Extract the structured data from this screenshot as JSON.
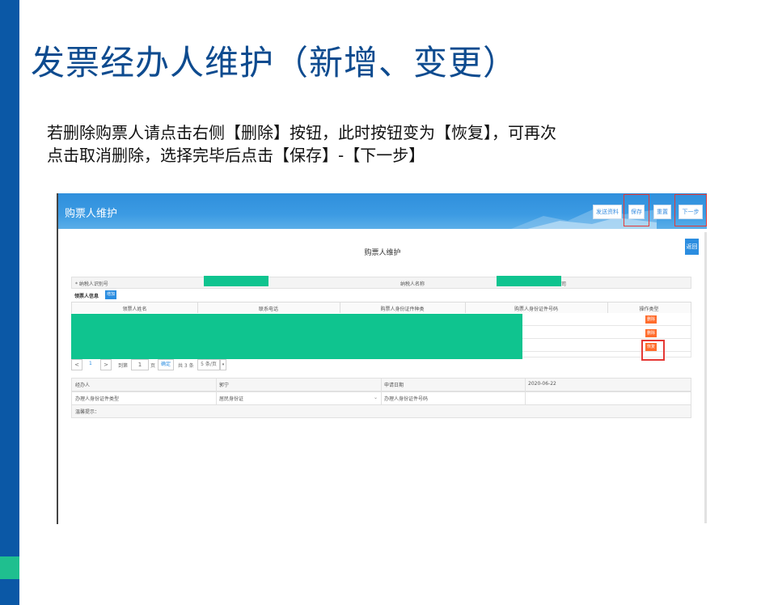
{
  "slide": {
    "title": "发票经办人维护（新增、变更）",
    "instruction_line1": "若删除购票人请点击右侧【删除】按钮，此时按钮变为【恢复】，可再次",
    "instruction_line2": "点击取消删除，选择完毕后点击【保存】-【下一步】"
  },
  "app": {
    "header_title": "购票人维护",
    "buttons": {
      "send": "发送资料",
      "save": "保存",
      "reset": "重置",
      "next": "下一步"
    },
    "back": "返回",
    "form_title": "购票人维护",
    "taxpayer_id_label": "* 纳税人识别号",
    "taxpayer_name_label": "纳税人名称",
    "taxpayer_name_suffix": "司",
    "section_label": "领票人信息",
    "add_button": "增加",
    "table_headers": [
      "领票人姓名",
      "联系电话",
      "购票人身份证件种类",
      "购票人身份证件号码",
      "操作类型"
    ],
    "row_actions": [
      "删除",
      "删除",
      "恢复"
    ],
    "pager": {
      "prev": "<",
      "page": "1",
      "next": ">",
      "goto": "到第",
      "page_input": "1",
      "page_unit": "页",
      "confirm": "确定",
      "total": "共 3 条",
      "per_page": "5 条/页"
    },
    "info": {
      "agent_label": "经办人",
      "agent_value": "郭宁",
      "apply_date_label": "申请日期",
      "apply_date_value": "2020-06-22",
      "id_type_label": "办理人身份证件类型",
      "id_type_value": "居民身份证",
      "id_no_label": "办理人身份证件号码",
      "tip_label": "温馨提示："
    }
  },
  "colors": {
    "brand": "#0b58a6",
    "header": "#3c9be3",
    "mask": "#0fc48f",
    "action": "#ff6c2c",
    "highlight": "#e53935"
  }
}
